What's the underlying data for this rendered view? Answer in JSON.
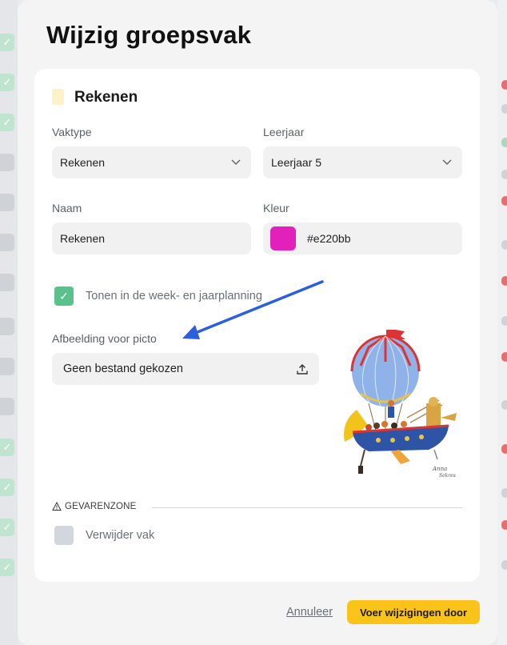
{
  "modal": {
    "title": "Wijzig groepsvak"
  },
  "card": {
    "heading": "Rekenen",
    "heading_swatch_color": "#fdf1c8"
  },
  "fields": {
    "vaktype": {
      "label": "Vaktype",
      "value": "Rekenen"
    },
    "leerjaar": {
      "label": "Leerjaar",
      "value": "Leerjaar 5"
    },
    "naam": {
      "label": "Naam",
      "value": "Rekenen"
    },
    "kleur": {
      "label": "Kleur",
      "value": "#e220bb",
      "swatch_color": "#e220bb"
    }
  },
  "planning_checkbox": {
    "label": "Tonen in de week- en jaarplanning",
    "checked": true,
    "color": "#5cc08b"
  },
  "picto": {
    "label": "Afbeelding voor picto",
    "file_text": "Geen bestand gekozen",
    "upload_icon": "upload-icon",
    "image_description_icon": "hot-air-balloon-ship-illustration"
  },
  "danger_zone": {
    "label": "GEVARENZONE",
    "icon": "warning-icon",
    "delete_label": "Verwijder vak",
    "delete_checked": false
  },
  "footer": {
    "cancel_label": "Annuleer",
    "save_label": "Voer wijzigingen door",
    "save_color": "#fac31a"
  },
  "annotation": {
    "arrow_color": "#2b5fe0"
  }
}
